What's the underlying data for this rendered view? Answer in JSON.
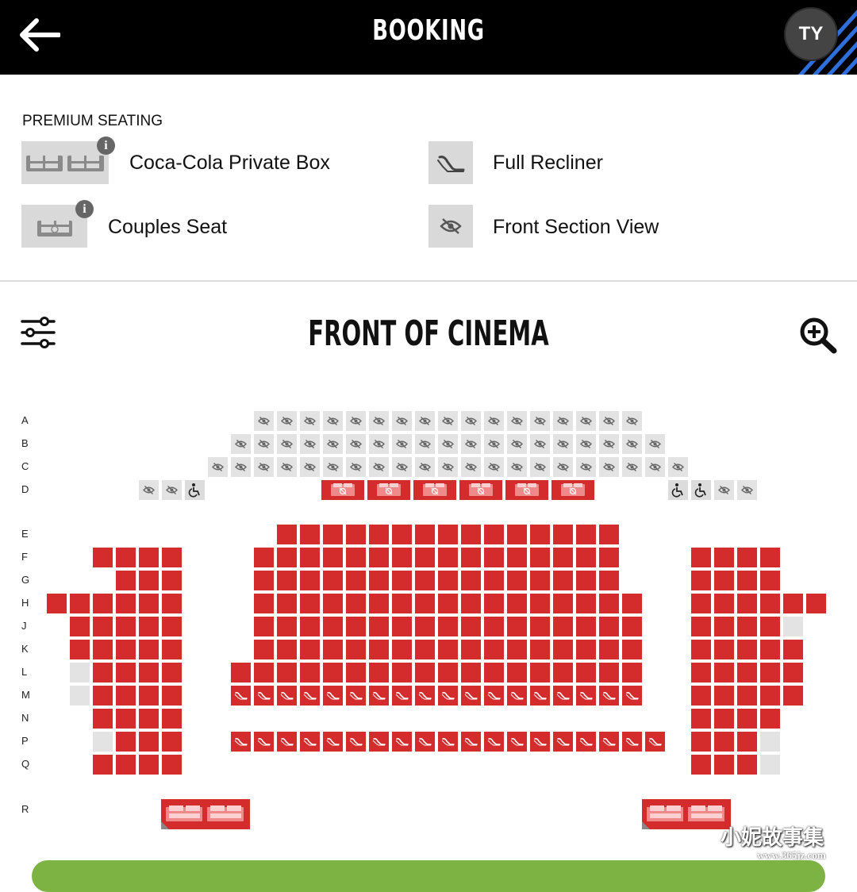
{
  "header": {
    "title": "BOOKING",
    "user_initials": "TY"
  },
  "legend": {
    "title": "PREMIUM SEATING",
    "items": [
      {
        "label": "Coca-Cola Private Box",
        "icon": "private-box-icon",
        "info": true
      },
      {
        "label": "Full Recliner",
        "icon": "recliner-icon",
        "info": false
      },
      {
        "label": "Couples Seat",
        "icon": "couples-seat-icon",
        "info": true
      },
      {
        "label": "Front Section View",
        "icon": "eye-off-icon",
        "info": false
      }
    ]
  },
  "screen_label": "FRONT OF CINEMA",
  "rows": [
    "A",
    "B",
    "C",
    "D",
    "E",
    "F",
    "G",
    "H",
    "J",
    "K",
    "L",
    "M",
    "N",
    "P",
    "Q",
    "R"
  ],
  "colors": {
    "available": "#d42c2c",
    "unavailable": "#e3e3e3",
    "header_bg": "#000000",
    "accent_stripe": "#2f6fdc",
    "action": "#7cb342"
  },
  "watermark": {
    "text": "小妮故事集",
    "url": "www.365jz.com"
  }
}
